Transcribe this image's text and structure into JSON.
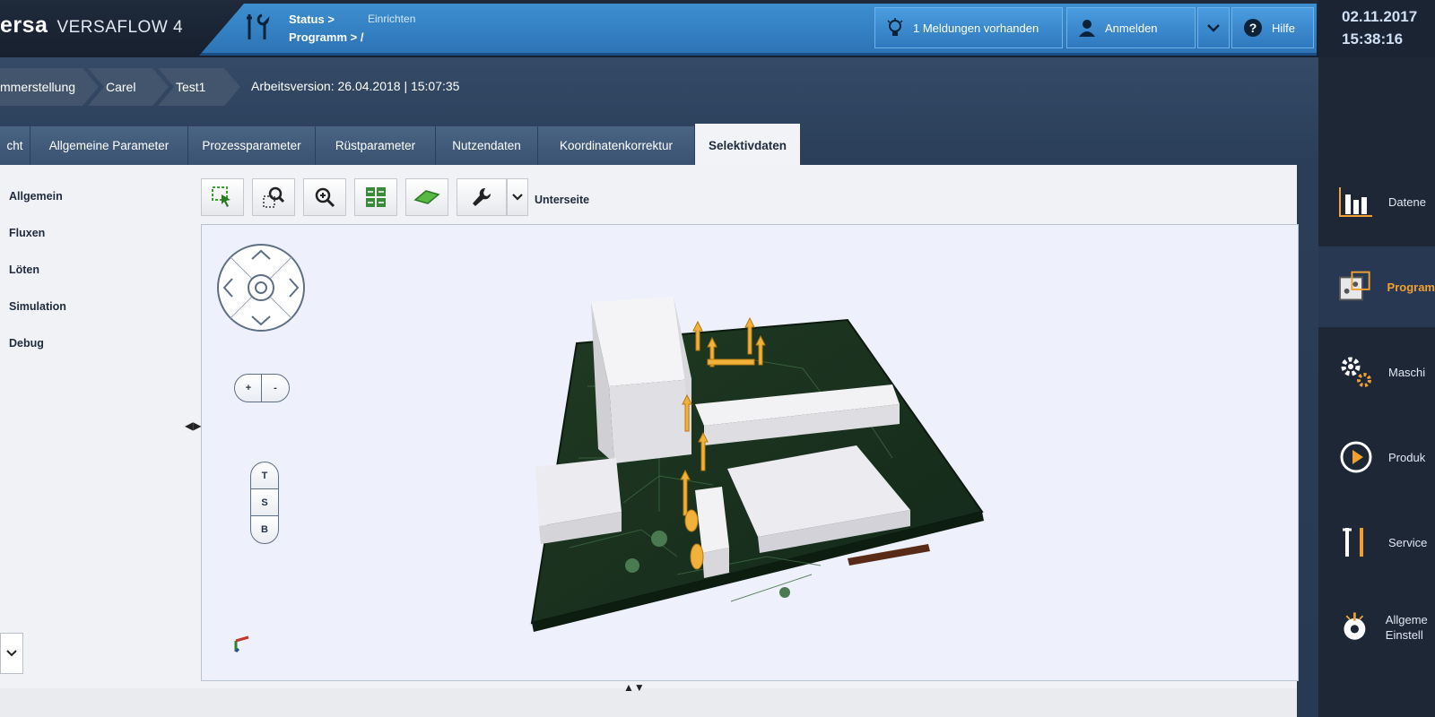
{
  "brand": {
    "name": "ersa",
    "product": "VERSAFLOW 4"
  },
  "status": {
    "status_label": "Status >",
    "status_value": "Einrichten",
    "program_label": "Programm > /"
  },
  "topbar": {
    "messages": "1 Meldungen vorhanden",
    "login": "Anmelden",
    "help": "Hilfe"
  },
  "clock": {
    "date": "02.11.2017",
    "time": "15:38:16"
  },
  "breadcrumb": [
    "mmerstellung",
    "Carel",
    "Test1"
  ],
  "work_version": "Arbeitsversion: 26.04.2018 | 15:07:35",
  "tabs": [
    "cht",
    "Allgemeine Parameter",
    "Prozessparameter",
    "Rüstparameter",
    "Nutzendaten",
    "Koordinatenkorrektur",
    "Selektivdaten"
  ],
  "active_tab": "Selektivdaten",
  "tree": [
    "Allgemein",
    "Fluxen",
    "Löten",
    "Simulation",
    "Debug"
  ],
  "toolbar": {
    "side_label": "Unterseite"
  },
  "view_controls": {
    "zoom_in": "+",
    "zoom_out": "-",
    "views": [
      "T",
      "S",
      "B"
    ]
  },
  "sidebar": [
    {
      "label": "Datene",
      "icon": "chart-icon"
    },
    {
      "label": "Program",
      "icon": "program-icon"
    },
    {
      "label": "Maschi",
      "icon": "gears-icon"
    },
    {
      "label": "Produk",
      "icon": "play-icon"
    },
    {
      "label": "Service",
      "icon": "tools-icon"
    },
    {
      "label": "Allgeme Einstell",
      "icon": "power-icon"
    }
  ],
  "colors": {
    "accent_blue": "#2f7ec4",
    "active_orange": "#f0a030",
    "pcb_green": "#1e3a22"
  }
}
